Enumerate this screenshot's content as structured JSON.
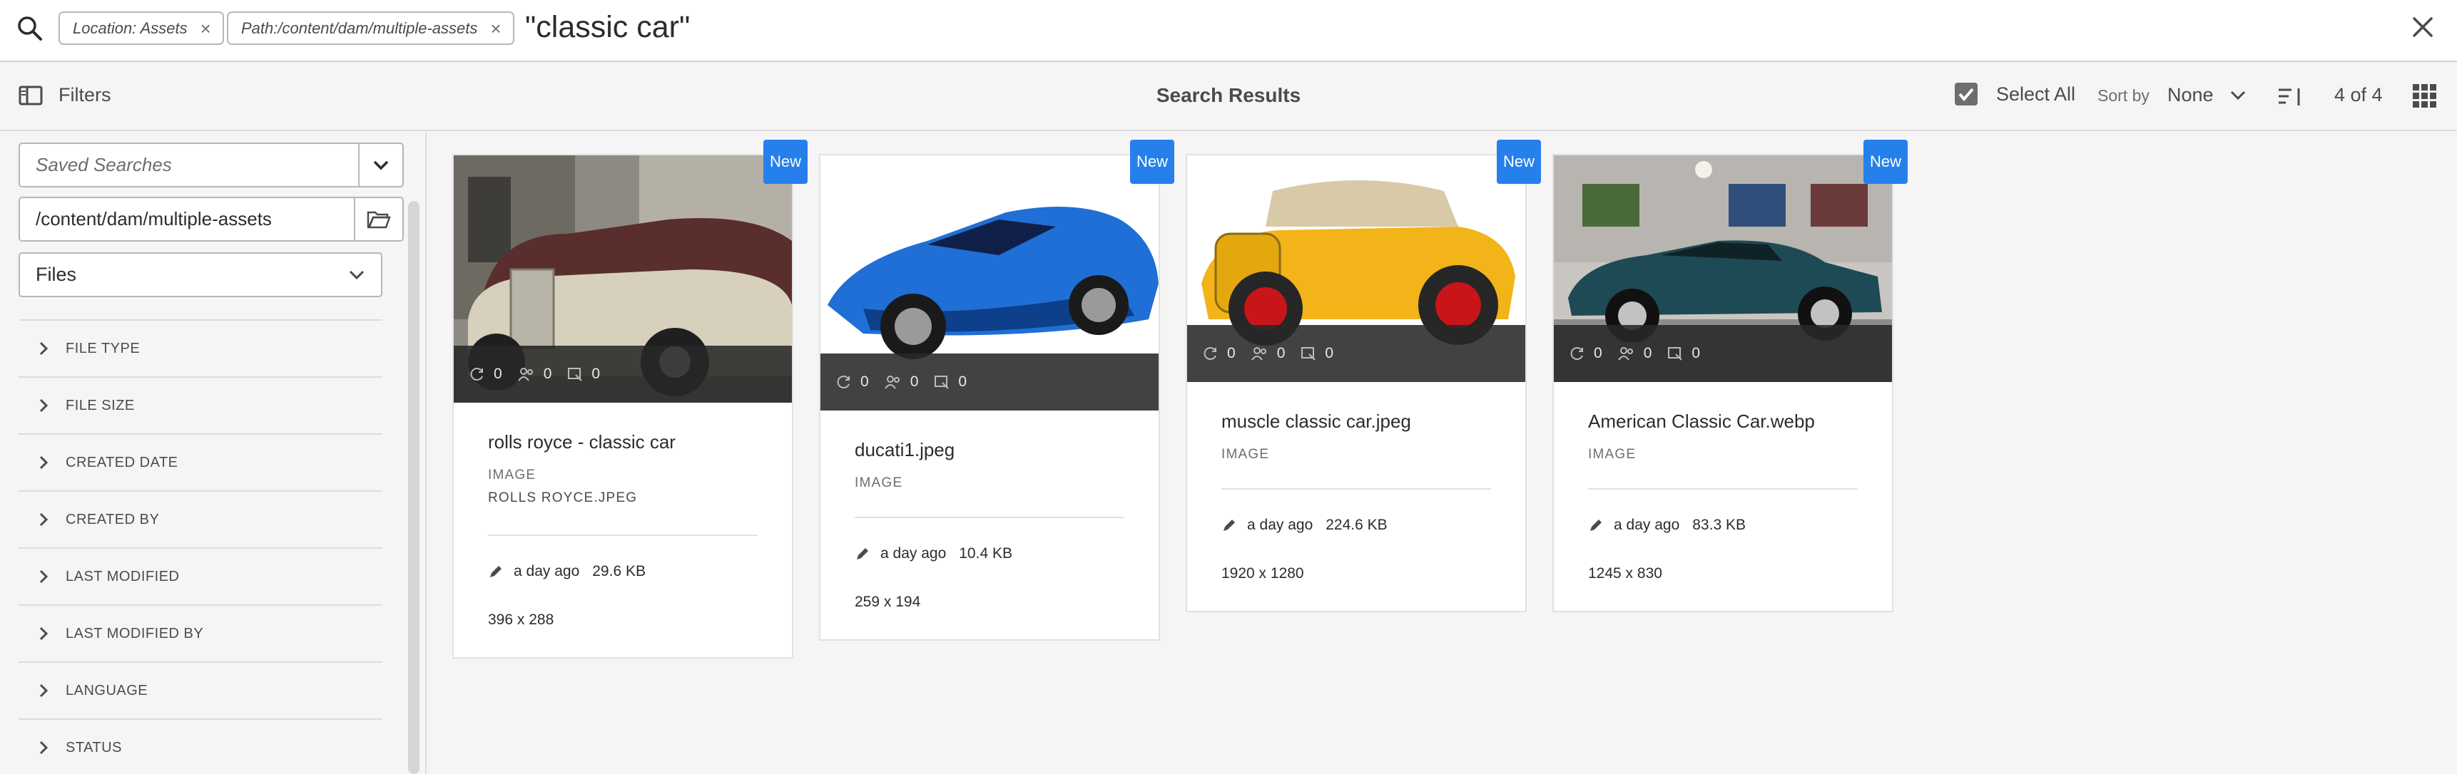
{
  "search": {
    "tags": [
      {
        "label": "Location: Assets"
      },
      {
        "label": "Path:/content/dam/multiple-assets"
      }
    ],
    "query": "\"classic car\""
  },
  "toolbar": {
    "filters_label": "Filters",
    "title": "Search Results",
    "select_all_label": "Select All",
    "sort_label": "Sort by",
    "sort_value": "None",
    "count": "4 of 4"
  },
  "sidebar": {
    "saved_searches_placeholder": "Saved Searches",
    "path_value": "/content/dam/multiple-assets",
    "file_filter": "Files",
    "facets": [
      "FILE TYPE",
      "FILE SIZE",
      "CREATED DATE",
      "CREATED BY",
      "LAST MODIFIED",
      "LAST MODIFIED BY",
      "LANGUAGE",
      "STATUS"
    ]
  },
  "cards": [
    {
      "badge": "New",
      "title": "rolls royce - classic car",
      "type": "IMAGE",
      "subtitle": "ROLLS ROYCE.JPEG",
      "modified": "a day ago",
      "size": "29.6 KB",
      "dimensions": "396 x 288",
      "stats": [
        "0",
        "0",
        "0"
      ]
    },
    {
      "badge": "New",
      "title": "ducati1.jpeg",
      "type": "IMAGE",
      "modified": "a day ago",
      "size": "10.4 KB",
      "dimensions": "259 x 194",
      "stats": [
        "0",
        "0",
        "0"
      ]
    },
    {
      "badge": "New",
      "title": "muscle classic car.jpeg",
      "type": "IMAGE",
      "modified": "a day ago",
      "size": "224.6 KB",
      "dimensions": "1920 x 1280",
      "stats": [
        "0",
        "0",
        "0"
      ]
    },
    {
      "badge": "New",
      "title": "American Classic Car.webp",
      "type": "IMAGE",
      "modified": "a day ago",
      "size": "83.3 KB",
      "dimensions": "1245 x 830",
      "stats": [
        "0",
        "0",
        "0"
      ]
    }
  ],
  "colors": {
    "accent": "#2680eb",
    "overlay": "#2f2f2f",
    "background": "#f5f5f5"
  }
}
